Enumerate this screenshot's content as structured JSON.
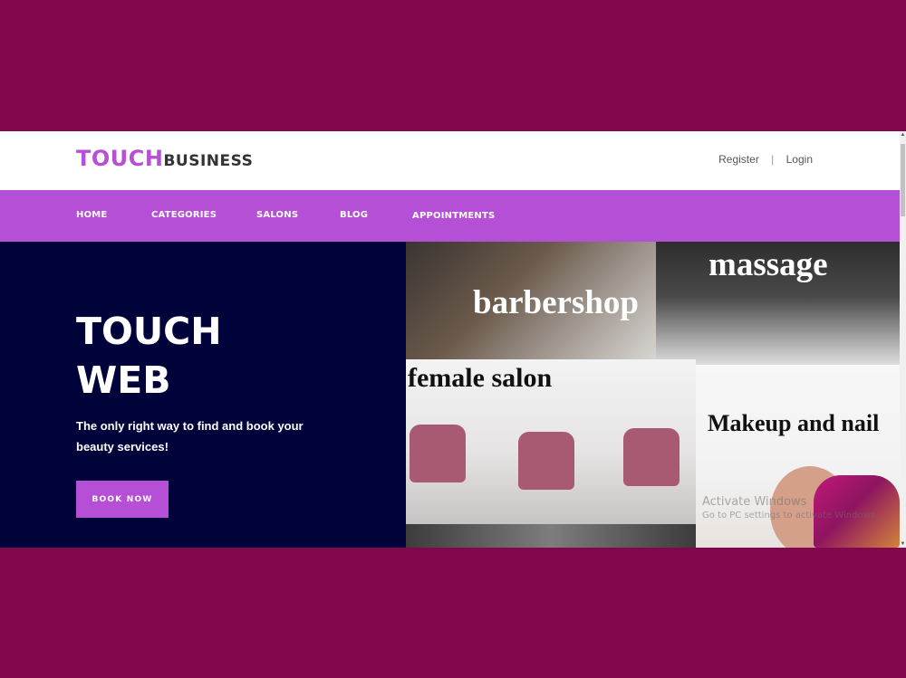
{
  "header": {
    "logo_part1": "TOUCH",
    "logo_part2": "BUSINESS",
    "register": "Register",
    "separator": "|",
    "login": "Login"
  },
  "nav": {
    "items": [
      "HOME",
      "CATEGORIES",
      "SALONS",
      "BLOG",
      "APPOINTMENTS"
    ]
  },
  "hero": {
    "title_line1": "TOUCH",
    "title_line2": "WEB",
    "subtitle": "The only right way to find and book your beauty services!",
    "button": "BOOK NOW"
  },
  "tiles": {
    "barbershop": "barbershop",
    "massage": "massage",
    "female_salon": "female salon",
    "makeup": "Makeup and nail"
  },
  "watermark": {
    "line1": "Activate Windows",
    "line2": "Go to PC settings to activate Windows."
  },
  "colors": {
    "frame": "#82074d",
    "accent": "#b54fd6",
    "hero_bg": "#00023a"
  }
}
